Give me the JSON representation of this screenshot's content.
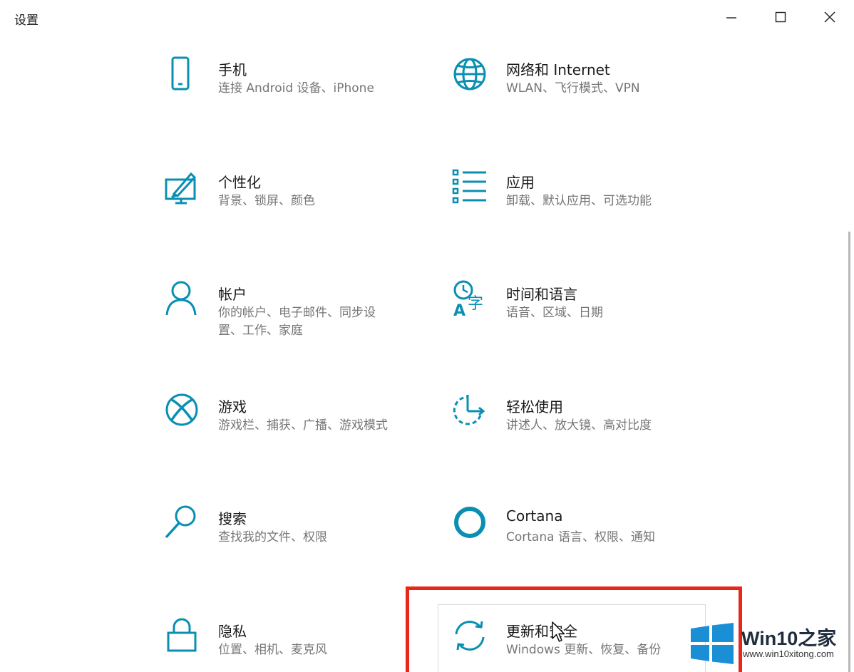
{
  "window": {
    "title": "设置",
    "accent_color": "#0a8fb3"
  },
  "tiles": [
    {
      "icon": "phone-icon",
      "title": "手机",
      "desc": "连接 Android 设备、iPhone"
    },
    {
      "icon": "globe-icon",
      "title": "网络和 Internet",
      "desc": "WLAN、飞行模式、VPN"
    },
    {
      "icon": "personalization-icon",
      "title": "个性化",
      "desc": "背景、锁屏、颜色"
    },
    {
      "icon": "apps-icon",
      "title": "应用",
      "desc": "卸载、默认应用、可选功能"
    },
    {
      "icon": "person-icon",
      "title": "帐户",
      "desc": "你的帐户、电子邮件、同步设置、工作、家庭"
    },
    {
      "icon": "time-language-icon",
      "title": "时间和语言",
      "desc": "语音、区域、日期"
    },
    {
      "icon": "xbox-icon",
      "title": "游戏",
      "desc": "游戏栏、捕获、广播、游戏模式"
    },
    {
      "icon": "ease-of-access-icon",
      "title": "轻松使用",
      "desc": "讲述人、放大镜、高对比度"
    },
    {
      "icon": "search-icon",
      "title": "搜索",
      "desc": "查找我的文件、权限"
    },
    {
      "icon": "cortana-icon",
      "title": "Cortana",
      "desc": "Cortana 语言、权限、通知"
    },
    {
      "icon": "lock-icon",
      "title": "隐私",
      "desc": "位置、相机、麦克风"
    },
    {
      "icon": "sync-icon",
      "title": "更新和安全",
      "desc": "Windows 更新、恢复、备份"
    }
  ],
  "annotation": {
    "highlight_color": "#e8261a",
    "highlighted_tile": "更新和安全"
  },
  "watermark": {
    "title": "Win10之家",
    "url": "www.win10xitong.com",
    "logo_color": "#1a8fd6"
  }
}
